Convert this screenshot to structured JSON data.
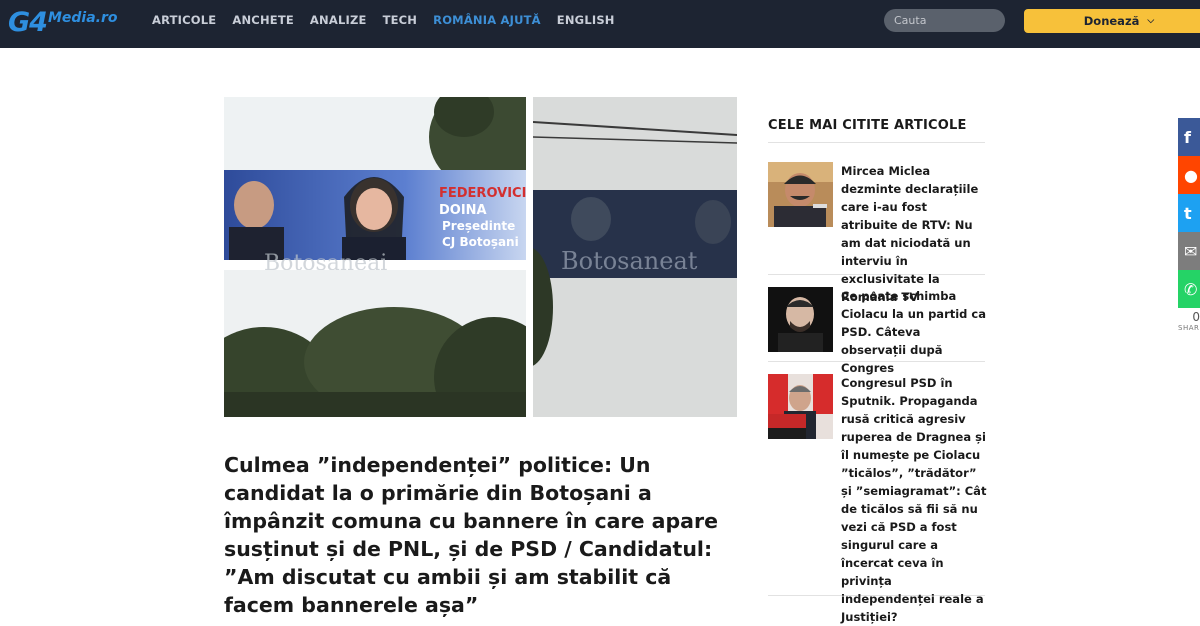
{
  "logo": {
    "g4": "G4",
    "media": "Media.ro"
  },
  "nav": {
    "items": [
      "ARTICOLE",
      "ANCHETE",
      "ANALIZE",
      "TECH",
      "ROMÂNIA AJUTĂ",
      "ENGLISH"
    ],
    "active": "ROMÂNIA AJUTĂ"
  },
  "search": {
    "placeholder": "Cauta"
  },
  "donate": {
    "label": "Donează"
  },
  "hero_image": {
    "banner_left": {
      "name": "FEDEROVICI",
      "first": "DOINA",
      "role": "Președinte",
      "org": "CJ Botoșani",
      "watermark": "Botosaneai"
    },
    "banner_right": {
      "watermark": "Botosaneat"
    }
  },
  "article": {
    "title": "Culmea ”independenței” politice: Un candidat la o primărie din Botoșani a împânzit comuna cu bannere în care apare susținut și de PNL, și de PSD / Candidatul: ”Am discutat cu ambii și am stabilit că facem bannerele așa”"
  },
  "sidebar": {
    "title": "CELE MAI CITITE ARTICOLE",
    "items": [
      {
        "text": "Mircea Miclea dezminte declarațiile care i-au fost atribuite de RTV: Nu am dat niciodată un interviu în exclusivitate la România TV"
      },
      {
        "text": "Ce poate schimba Ciolacu la un partid ca PSD. Câteva observații după Congres"
      },
      {
        "text": "Congresul PSD în Sputnik. Propaganda rusă critică agresiv ruperea de Dragnea și îl numește pe Ciolacu ”ticălos”, ”trădător” și ”semiagramat”: Cât de ticălos să fii să nu vezi că PSD a fost singurul care a încercat ceva în privința independenței reale a Justiției?"
      }
    ]
  },
  "share": {
    "buttons": [
      {
        "icon": "facebook-icon",
        "glyph": "f",
        "color": "#3b5998"
      },
      {
        "icon": "reddit-icon",
        "glyph": "●",
        "color": "#ff4500"
      },
      {
        "icon": "twitter-icon",
        "glyph": "t",
        "color": "#1da1f2"
      },
      {
        "icon": "email-icon",
        "glyph": "✉",
        "color": "#7d7d7d"
      },
      {
        "icon": "whatsapp-icon",
        "glyph": "✆",
        "color": "#25d366"
      }
    ],
    "count": "0",
    "label": "SHARES"
  }
}
